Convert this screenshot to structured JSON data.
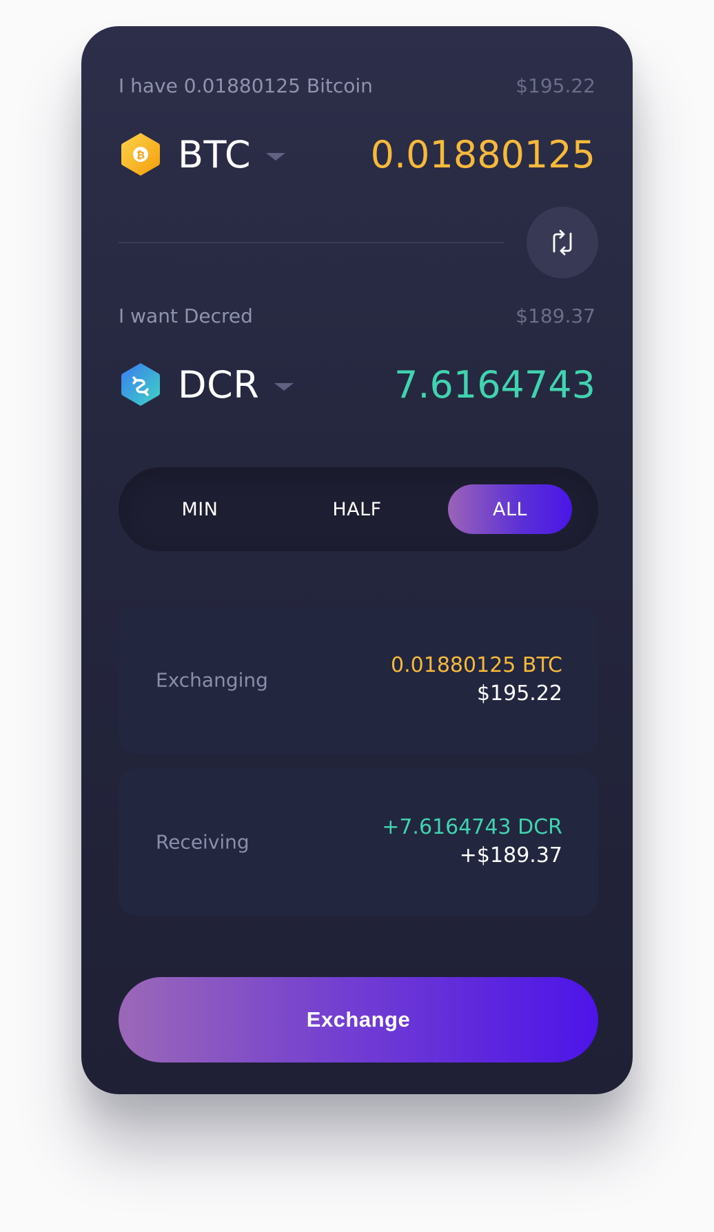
{
  "from": {
    "label": "I have 0.01880125 Bitcoin",
    "usd": "$195.22",
    "code": "BTC",
    "amount": "0.01880125",
    "icon": "bitcoin-hex-icon",
    "color": "#f6b93b"
  },
  "to": {
    "label": "I want Decred",
    "usd": "$189.37",
    "code": "DCR",
    "amount": "7.6164743",
    "icon": "decred-hex-icon",
    "color": "#41d3b0"
  },
  "amount_selector": {
    "options": [
      "MIN",
      "HALF",
      "ALL"
    ],
    "selected": "ALL"
  },
  "summary": {
    "exchanging": {
      "label": "Exchanging",
      "crypto": "0.01880125 BTC",
      "fiat": "$195.22"
    },
    "receiving": {
      "label": "Receiving",
      "crypto": "+7.6164743 DCR",
      "fiat": "+$189.37"
    }
  },
  "exchange_button": {
    "label": "Exchange"
  },
  "colors": {
    "card_bg": "#282a43",
    "accent_start": "#9b68b8",
    "accent_end": "#4d14e8",
    "btc": "#f6b93b",
    "dcr": "#41d3b0"
  }
}
